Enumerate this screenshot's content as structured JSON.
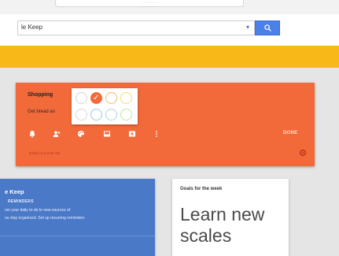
{
  "browser": {
    "omnibox_text": "··········"
  },
  "search": {
    "query": "le Keep",
    "chevron": "▾"
  },
  "colors": {
    "keep_header": "#f8b818",
    "shopping_card": "#f26a3a",
    "keep_card": "#4a79c8",
    "search_button": "#4a80e8",
    "palette_selected": "#f26a3a"
  },
  "shopping_note": {
    "title": "Shopping",
    "body": "Get bread an",
    "done_label": "DONE",
    "edited_text": "Edited Jun 9:00 AM",
    "toolbar_icons": [
      "reminder-icon",
      "collaborator-icon",
      "color-palette-icon",
      "image-icon",
      "archive-icon",
      "more-icon"
    ],
    "palette": [
      {
        "name": "white",
        "color": "#ffffff"
      },
      {
        "name": "red",
        "color": "#f26a3a",
        "selected": true
      },
      {
        "name": "orange",
        "color": "#f5b86a"
      },
      {
        "name": "yellow",
        "color": "#f2e56a"
      },
      {
        "name": "gray",
        "color": "#d8d8d8"
      },
      {
        "name": "blue",
        "color": "#9fc5e8"
      },
      {
        "name": "teal",
        "color": "#a8d8dc"
      },
      {
        "name": "green",
        "color": "#c5e3a5"
      }
    ]
  },
  "keep_card": {
    "title": "e Keep",
    "label": "REMINDERS",
    "line1": "om your daily to-do to new sources of",
    "line2": "ou stay organized. Set up recurring reminders"
  },
  "goals_card": {
    "title": "Goals for the week",
    "line1": "Learn new",
    "line2": "scales"
  }
}
